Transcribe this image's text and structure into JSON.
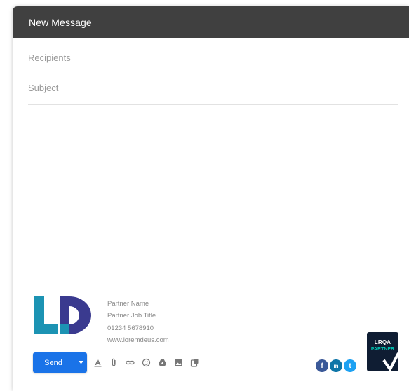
{
  "compose": {
    "title": "New Message",
    "recipients_placeholder": "Recipients",
    "subject_placeholder": "Subject",
    "send_label": "Send",
    "send_menu_icon": "triangle-down",
    "tools": [
      {
        "name": "format-text-icon",
        "glyph": "format"
      },
      {
        "name": "attach-file-icon",
        "glyph": "clip"
      },
      {
        "name": "insert-link-icon",
        "glyph": "link"
      },
      {
        "name": "insert-emoji-icon",
        "glyph": "emoji"
      },
      {
        "name": "google-drive-icon",
        "glyph": "drive"
      },
      {
        "name": "insert-photo-icon",
        "glyph": "photo"
      },
      {
        "name": "confidential-mode-icon",
        "glyph": "lock"
      }
    ]
  },
  "signature": {
    "logo": {
      "text": "LD",
      "primary_color": "#1c93b3",
      "secondary_color": "#3a3a8f"
    },
    "name": "Partner Name",
    "job_title": "Partner Job Title",
    "phone": "01234 5678910",
    "website": "www.loremdeus.com"
  },
  "social": [
    {
      "name": "facebook-icon",
      "glyph": "f",
      "color": "#3b5998"
    },
    {
      "name": "linkedin-icon",
      "glyph": "in",
      "color": "#0e76a8"
    },
    {
      "name": "twitter-icon",
      "glyph": "t",
      "color": "#1da1f2"
    }
  ],
  "badge": {
    "top_text": "LRQA",
    "bottom_text": "PARTNER",
    "accent_color": "#00c2b2"
  },
  "colors": {
    "header_bg": "#404040",
    "send_button": "#1a73e8"
  }
}
